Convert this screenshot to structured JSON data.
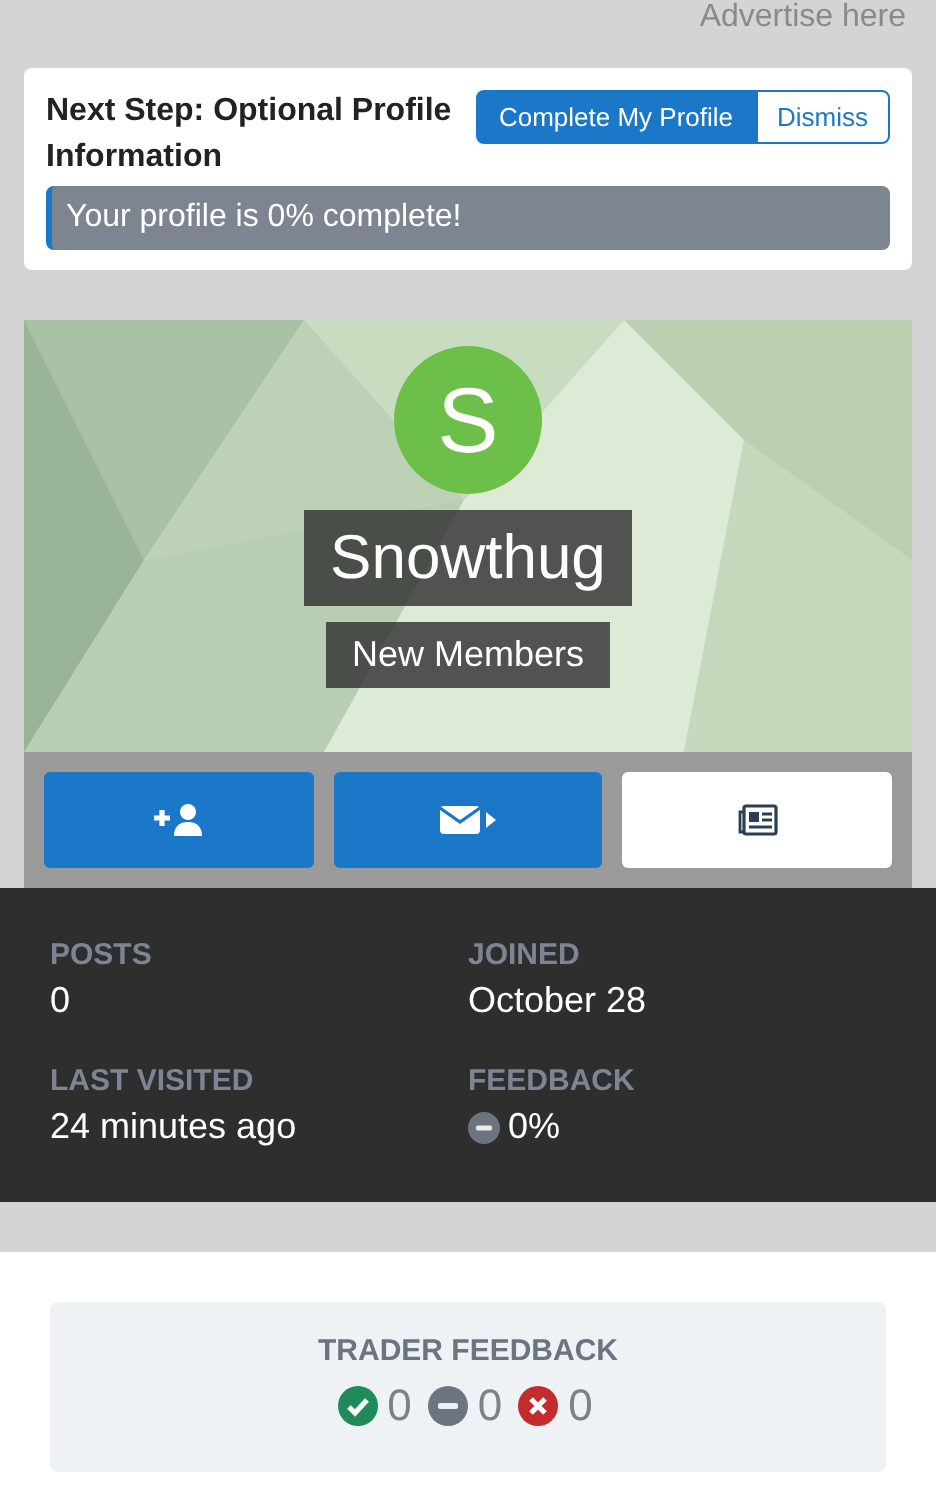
{
  "advert": {
    "label": "Advertise here"
  },
  "next_step": {
    "title": "Next Step: Optional Profile Information",
    "buttons": [
      {
        "label": "Complete My Profile",
        "kind": "primary"
      },
      {
        "label": "Dismiss",
        "kind": "outline"
      }
    ],
    "progress": {
      "label": "Your profile is 0% complete!",
      "level": 0
    }
  },
  "profile": {
    "avatar_letter": "S",
    "name": "Snowthug",
    "group": "New Members",
    "actions": [
      {
        "kind": "follow"
      },
      {
        "kind": "message"
      },
      {
        "kind": "about"
      }
    ]
  },
  "stats": [
    {
      "label": "POSTS",
      "value": "0"
    },
    {
      "label": "JOINED",
      "value": "October 28"
    },
    {
      "label": "LAST VISITED",
      "value": "24 minutes ago"
    },
    {
      "label": "FEEDBACK",
      "value": "0%",
      "kind": "neutral"
    }
  ],
  "trader_feedback": {
    "title": "TRADER FEEDBACK",
    "counts": [
      {
        "kind": "positive",
        "value": "0"
      },
      {
        "kind": "neutral",
        "value": "0"
      },
      {
        "kind": "negative",
        "value": "0"
      }
    ]
  }
}
